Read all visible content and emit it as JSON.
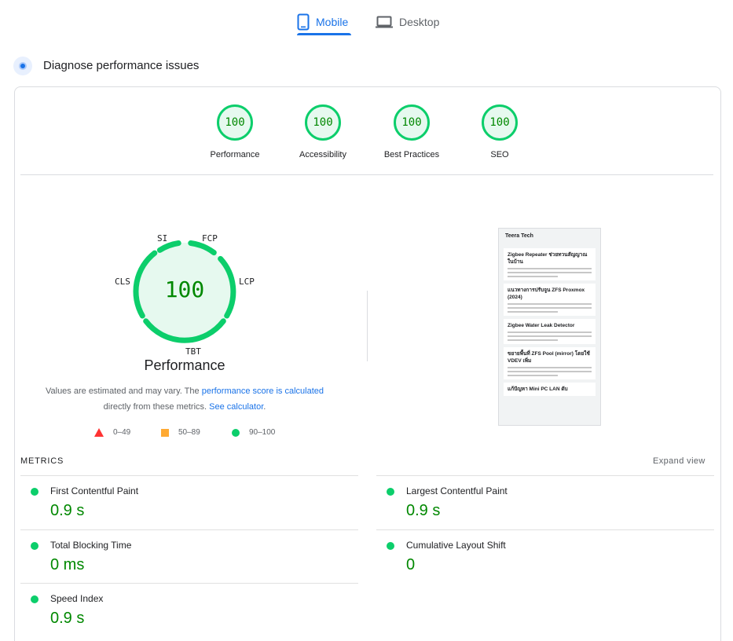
{
  "tabs": {
    "mobile": "Mobile",
    "desktop": "Desktop",
    "active": "Mobile",
    "accent_color": "#1a73e8"
  },
  "header": {
    "title": "Diagnose performance issues"
  },
  "categories": [
    {
      "score": "100",
      "label": "Performance"
    },
    {
      "score": "100",
      "label": "Accessibility"
    },
    {
      "score": "100",
      "label": "Best Practices"
    },
    {
      "score": "100",
      "label": "SEO"
    }
  ],
  "gauge": {
    "score": "100",
    "title": "Performance",
    "labels": {
      "si": "SI",
      "fcp": "FCP",
      "lcp": "LCP",
      "tbt": "TBT",
      "cls": "CLS"
    },
    "color_pass": "#0cce6b",
    "text_color_pass": "#008800"
  },
  "description": {
    "part1": "Values are estimated and may vary. The ",
    "link1": "performance score is calculated",
    "part2": " directly from these metrics. ",
    "link2": "See calculator",
    "part3": "."
  },
  "legend": [
    {
      "range": "0–49",
      "shape": "triangle",
      "color": "#ff3333"
    },
    {
      "range": "50–89",
      "shape": "square",
      "color": "#ffaa33"
    },
    {
      "range": "90–100",
      "shape": "circle",
      "color": "#0cce6b"
    }
  ],
  "screenshot": {
    "site": "Teera Tech",
    "posts": [
      {
        "title": "Zigbee Repeater ช่วยทวนสัญญาณในบ้าน"
      },
      {
        "title": "แนวทางการปรับจูน ZFS Proxmox (2024)"
      },
      {
        "title": "Zigbee Water Leak Detector"
      },
      {
        "title": "ขยายพื้นที่ ZFS Pool (mirror) โดยใช้ VDEV เพิ่ม"
      },
      {
        "title": "แก้ปัญหา Mini PC LAN ดับ"
      }
    ]
  },
  "metrics": {
    "label": "METRICS",
    "expand": "Expand view",
    "items": [
      {
        "name": "First Contentful Paint",
        "value": "0.9 s"
      },
      {
        "name": "Largest Contentful Paint",
        "value": "0.9 s"
      },
      {
        "name": "Total Blocking Time",
        "value": "0 ms"
      },
      {
        "name": "Cumulative Layout Shift",
        "value": "0"
      },
      {
        "name": "Speed Index",
        "value": "0.9 s"
      }
    ]
  }
}
